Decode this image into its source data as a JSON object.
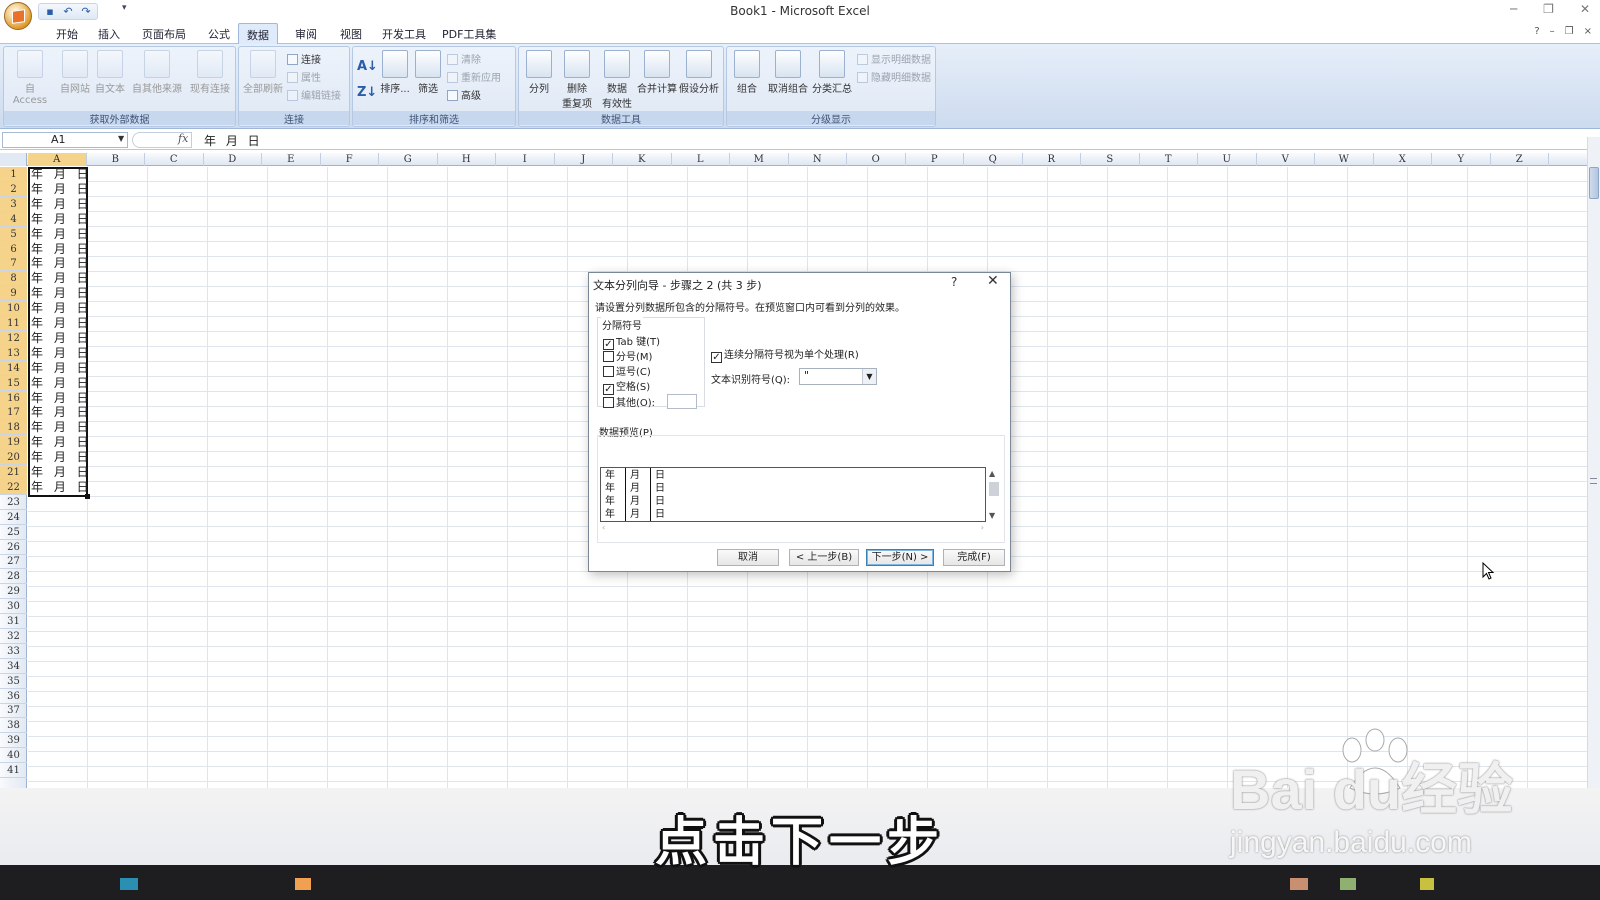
{
  "window": {
    "title": "Book1 - Microsoft Excel",
    "controls": [
      "─",
      "❐",
      "✕"
    ]
  },
  "ribbon_tabs": [
    "开始",
    "插入",
    "页面布局",
    "公式",
    "数据",
    "审阅",
    "视图",
    "开发工具",
    "PDF工具集"
  ],
  "active_tab": "数据",
  "ribbon": {
    "external_data": {
      "label": "获取外部数据",
      "buttons": [
        "自 Access",
        "自网站",
        "自文本",
        "自其他来源",
        "现有连接"
      ]
    },
    "connections": {
      "label": "连接",
      "refresh_all": "全部刷新",
      "items": [
        "连接",
        "属性",
        "编辑链接"
      ]
    },
    "sort_filter": {
      "label": "排序和筛选",
      "sort": "排序...",
      "filter": "筛选",
      "items": [
        "清除",
        "重新应用",
        "高级"
      ]
    },
    "data_tools": {
      "label": "数据工具",
      "buttons": [
        "分列",
        "删除",
        "重复项",
        "数据",
        "有效性",
        "合并计算",
        "假设分析"
      ]
    },
    "outline": {
      "label": "分级显示",
      "buttons": [
        "组合",
        "取消组合",
        "分类汇总"
      ],
      "items": [
        "显示明细数据",
        "隐藏明细数据"
      ]
    }
  },
  "formula_bar": {
    "name_box": "A1",
    "fx": "fx",
    "content": "年 月 日"
  },
  "sheet": {
    "columns": [
      "A",
      "B",
      "C",
      "D",
      "E",
      "F",
      "G",
      "H",
      "I",
      "J",
      "K",
      "L",
      "M",
      "N",
      "O",
      "P",
      "Q",
      "R",
      "S",
      "T",
      "U",
      "V",
      "W",
      "X",
      "Y",
      "Z"
    ],
    "rows": [
      "1",
      "2",
      "3",
      "4",
      "5",
      "6",
      "7",
      "8",
      "9",
      "10",
      "11",
      "12",
      "13",
      "14",
      "15",
      "16",
      "17",
      "18",
      "19",
      "20",
      "21",
      "22",
      "23",
      "24",
      "25",
      "26",
      "27",
      "28",
      "29",
      "30",
      "31",
      "32",
      "33",
      "34",
      "35",
      "36",
      "37",
      "38",
      "39",
      "40",
      "41"
    ],
    "column_a_values": [
      "年 月 日",
      "年 月 日",
      "年 月 日",
      "年 月 日",
      "年 月 日",
      "年 月 日",
      "年 月 日",
      "年 月 日",
      "年 月 日",
      "年 月 日",
      "年 月 日",
      "年 月 日",
      "年 月 日",
      "年 月 日",
      "年 月 日",
      "年 月 日",
      "年 月 日",
      "年 月 日",
      "年 月 日",
      "年 月 日",
      "年 月 日",
      "年 月 日"
    ]
  },
  "dialog": {
    "title": "文本分列向导 - 步骤之 2 (共 3 步)",
    "help": "?",
    "close": "✕",
    "description": "请设置分列数据所包含的分隔符号。在预览窗口内可看到分列的效果。",
    "delimiters_legend": "分隔符号",
    "delimiters": [
      {
        "label": "Tab 键(T)",
        "checked": true
      },
      {
        "label": "分号(M)",
        "checked": false
      },
      {
        "label": "逗号(C)",
        "checked": false
      },
      {
        "label": "空格(S)",
        "checked": true
      },
      {
        "label": "其他(O):",
        "checked": false
      }
    ],
    "consecutive": {
      "label": "连续分隔符号视为单个处理(R)",
      "checked": true
    },
    "qualifier_label": "文本识别符号(Q):",
    "qualifier_value": "\"",
    "preview_label": "数据预览(P)",
    "preview_rows": [
      [
        "年",
        "月",
        "日"
      ],
      [
        "年",
        "月",
        "日"
      ],
      [
        "年",
        "月",
        "日"
      ],
      [
        "年",
        "月",
        "日"
      ]
    ],
    "buttons": {
      "cancel": "取消",
      "back": "< 上一步(B)",
      "next": "下一步(N) >",
      "finish": "完成(F)"
    }
  },
  "overlay": {
    "caption": "点击下一步",
    "watermark_logo": "Bai du经验",
    "watermark_url": "jingyan.baidu.com"
  }
}
